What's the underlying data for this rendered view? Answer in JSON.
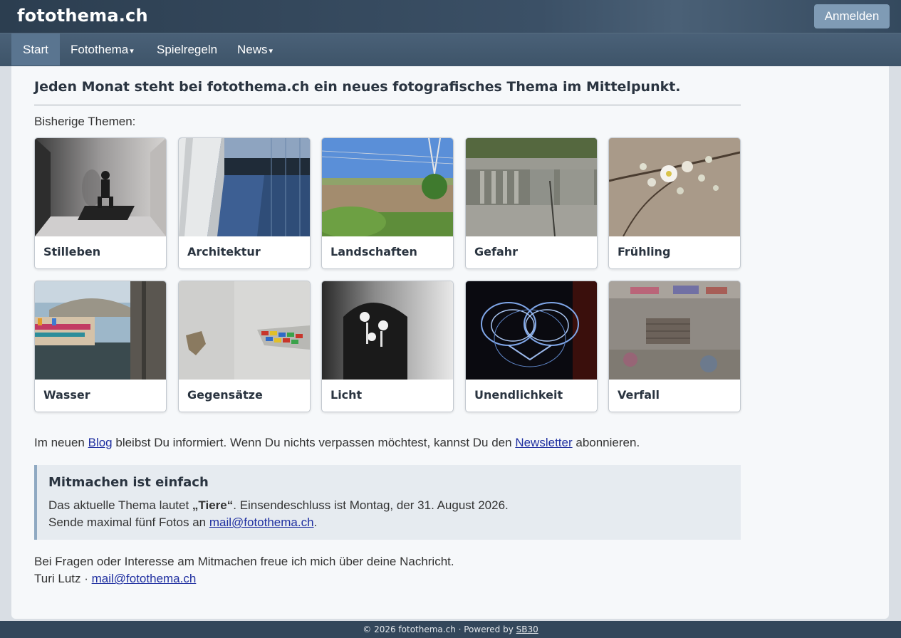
{
  "header": {
    "brand": "fotothema.ch",
    "login_label": "Anmelden"
  },
  "nav": {
    "items": [
      {
        "label": "Start",
        "active": true
      },
      {
        "label": "Fotothema",
        "dropdown": true
      },
      {
        "label": "Spielregeln"
      },
      {
        "label": "News",
        "dropdown": true
      }
    ],
    "caret": "▾"
  },
  "main": {
    "intro": "Jeden Monat steht bei fotothema.ch ein neues fotografisches Thema im Mittelpunkt.",
    "subtitle": "Bisherige Themen:",
    "themes": [
      {
        "label": "Stilleben"
      },
      {
        "label": "Architektur"
      },
      {
        "label": "Landschaften"
      },
      {
        "label": "Gefahr"
      },
      {
        "label": "Frühling"
      },
      {
        "label": "Wasser"
      },
      {
        "label": "Gegensätze"
      },
      {
        "label": "Licht"
      },
      {
        "label": "Unendlichkeit"
      },
      {
        "label": "Verfall"
      }
    ],
    "blog_line": {
      "prefix": "Im neuen ",
      "blog_link": "Blog",
      "middle": " bleibst Du informiert. Wenn Du nichts verpassen möchtest, kannst Du den ",
      "newsletter_link": "Newsletter",
      "suffix": " abonnieren."
    },
    "callout": {
      "title": "Mitmachen ist einfach",
      "line1_prefix": "Das aktuelle Thema lautet ",
      "theme": "„Tiere“",
      "line1_suffix": ". Einsendeschluss ist Montag, der 31. August 2026.",
      "line2_prefix": "Sende maximal fünf Fotos an ",
      "email": "mail@fotothema.ch",
      "line2_suffix": "."
    },
    "contact": {
      "line1": "Bei Fragen oder Interesse am Mitmachen freue ich mich über deine Nachricht.",
      "name": "Turi Lutz · ",
      "email": "mail@fotothema.ch"
    }
  },
  "footer": {
    "text": "© 2026 fotothema.ch · Powered by ",
    "link": "SB30"
  }
}
